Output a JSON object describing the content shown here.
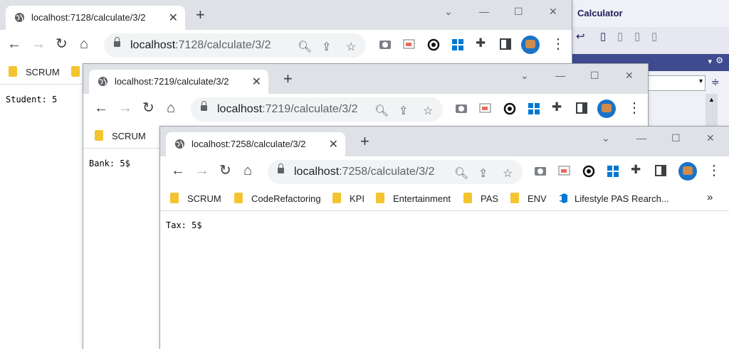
{
  "vs": {
    "title": "Calculator"
  },
  "windows": [
    {
      "tab_title": "localhost:7128/calculate/3/2",
      "url_host": "localhost",
      "url_rest": ":7128/calculate/3/2",
      "bookmarks": [
        "SCRUM"
      ],
      "content": "Student: 5"
    },
    {
      "tab_title": "localhost:7219/calculate/3/2",
      "url_host": "localhost",
      "url_rest": ":7219/calculate/3/2",
      "bookmarks": [
        "SCRUM"
      ],
      "content": "Bank: 5$"
    },
    {
      "tab_title": "localhost:7258/calculate/3/2",
      "url_host": "localhost",
      "url_rest": ":7258/calculate/3/2",
      "bookmarks": [
        "SCRUM",
        "CodeRefactoring",
        "KPI",
        "Entertainment",
        "PAS",
        "ENV",
        "Lifestyle PAS Rearch..."
      ],
      "overflow": "»",
      "content": "Tax: 5$"
    }
  ],
  "icons": {
    "back": "arrow-left-icon",
    "forward": "arrow-right-icon",
    "reload": "reload-icon",
    "home": "home-icon",
    "zoom": "zoom-icon",
    "share": "share-icon",
    "star": "star-icon",
    "extensions": "puzzle-icon"
  },
  "colors": {
    "tabstrip": "#dee1e6",
    "omnibox": "#f1f3f4",
    "folder": "#f4c430",
    "vs_bg": "#f0f0f7"
  }
}
